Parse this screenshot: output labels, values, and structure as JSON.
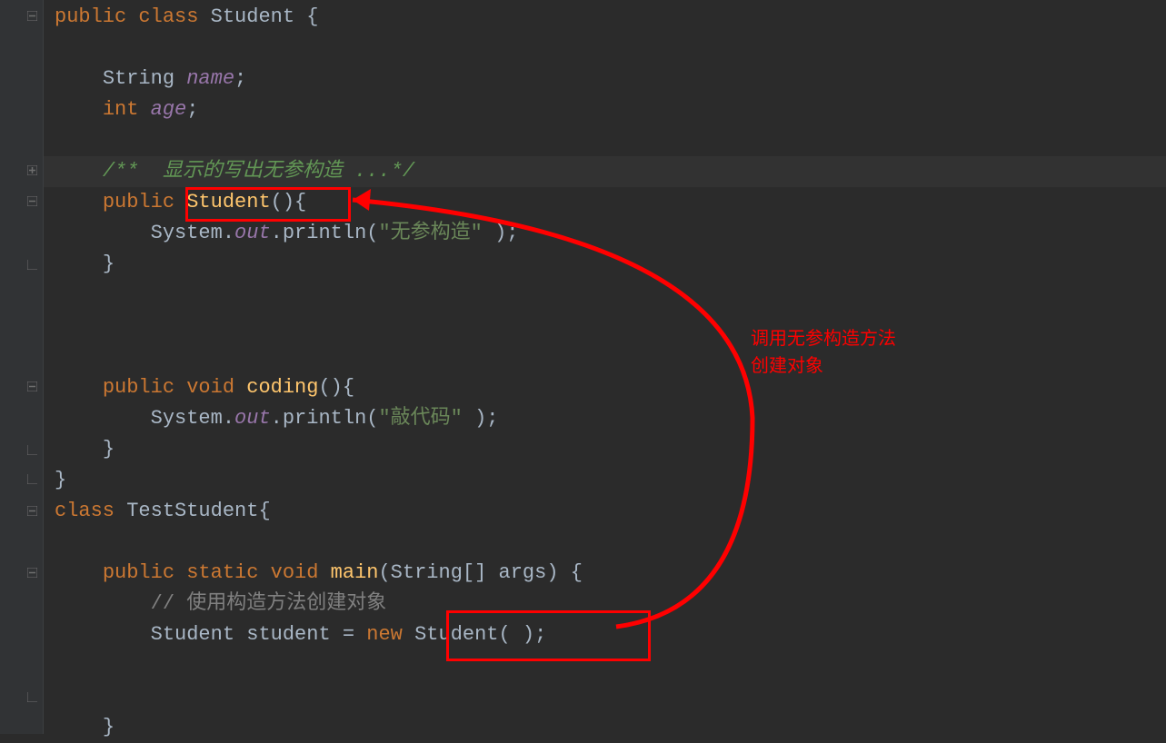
{
  "code": {
    "line1_public": "public",
    "line1_class": " class",
    "line1_name": " Student",
    "line1_brace": " {",
    "line3_type": "String",
    "line3_name": " name",
    "line3_semi": ";",
    "line4_type": "int",
    "line4_name": " age",
    "line4_semi": ";",
    "line6_comment": "/**  显示的写出无参构造 ...*/",
    "line7_public": "public",
    "line7_name": " Student",
    "line7_parens": "(){",
    "line8_sys": "System.",
    "line8_out": "out",
    "line8_println": ".println(",
    "line8_str": "\"无参构造\"",
    "line8_end": " );",
    "line9_brace": "}",
    "line13_public": "public",
    "line13_void": " void",
    "line13_name": " coding",
    "line13_parens": "(){",
    "line14_sys": "System.",
    "line14_out": "out",
    "line14_println": ".println(",
    "line14_str": "\"敲代码\"",
    "line14_end": " );",
    "line15_brace": "}",
    "line16_brace": "}",
    "line17_class": "class",
    "line17_name": " TestStudent",
    "line17_brace": "{",
    "line19_public": "public",
    "line19_static": " static",
    "line19_void": " void",
    "line19_main": " main",
    "line19_args": "(String[] args) {",
    "line20_comment": "// 使用构造方法创建对象",
    "line21_type": "Student student",
    "line21_eq": " = ",
    "line21_new": "new",
    "line21_ctor": " Student",
    "line21_parens": "( );",
    "line24_brace": "}"
  },
  "annotation": {
    "text_line1": "调用无参构造方法",
    "text_line2": "创建对象"
  }
}
